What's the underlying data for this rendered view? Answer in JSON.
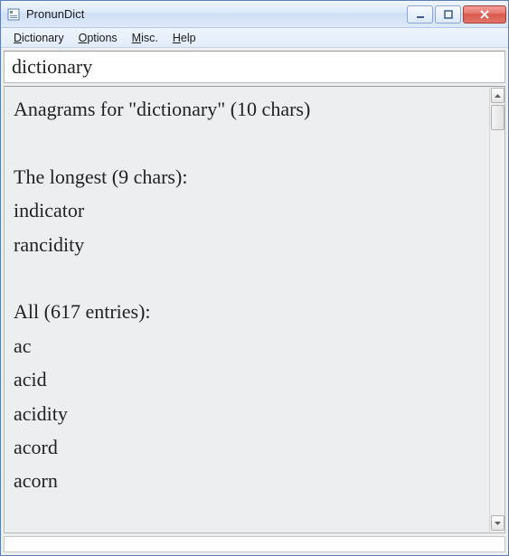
{
  "window": {
    "title": "PronunDict"
  },
  "menubar": {
    "items": [
      {
        "label": "Dictionary",
        "accel": "D"
      },
      {
        "label": "Options",
        "accel": "O"
      },
      {
        "label": "Misc.",
        "accel": "M"
      },
      {
        "label": "Help",
        "accel": "H"
      }
    ]
  },
  "search": {
    "value": "dictionary"
  },
  "results": {
    "heading": "Anagrams for \"dictionary\" (10 chars)",
    "longest_heading": "The longest (9 chars):",
    "longest": [
      "indicator",
      "rancidity"
    ],
    "all_heading": "All (617 entries):",
    "all_visible": [
      "ac",
      "acid",
      "acidity",
      "acord",
      "acorn"
    ]
  }
}
